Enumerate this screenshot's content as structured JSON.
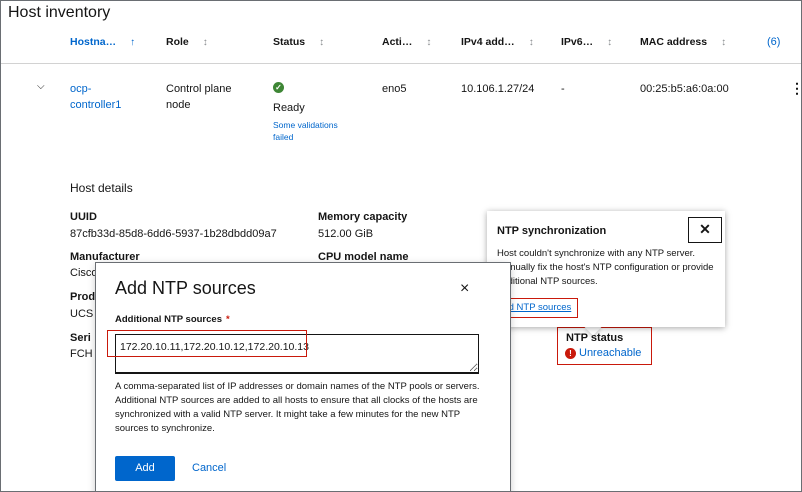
{
  "page": {
    "title": "Host inventory"
  },
  "table": {
    "columns": [
      {
        "label": "Hostna…",
        "sort_icon": "↑"
      },
      {
        "label": "Role",
        "sort_icon": "↕"
      },
      {
        "label": "Status",
        "sort_icon": "↕"
      },
      {
        "label": "Acti…",
        "sort_icon": "↕"
      },
      {
        "label": "IPv4 add…",
        "sort_icon": "↕"
      },
      {
        "label": "IPv6…",
        "sort_icon": "↕"
      },
      {
        "label": "MAC address",
        "sort_icon": "↕"
      }
    ],
    "count": "(6)",
    "row": {
      "hostname": "ocp-controller1",
      "role": "Control plane node",
      "status": "Ready",
      "status_note": "Some validations failed",
      "active_nic": "eno5",
      "ipv4": "10.106.1.27/24",
      "ipv6": "-",
      "mac": "00:25:b5:a6:0a:00"
    }
  },
  "details": {
    "title": "Host details",
    "uuid_label": "UUID",
    "uuid_value": "87cfb33d-85d8-6dd6-5937-1b28dbdd09a7",
    "memory_label": "Memory capacity",
    "memory_value": "512.00 GiB",
    "manufacturer_label": "Manufacturer",
    "manufacturer_value": "Cisco",
    "cpu_label": "CPU model name",
    "product_label": "Prod",
    "product_value": "UCS",
    "serial_label": "Seri",
    "serial_value": "FCH",
    "ntp_status_label": "NTP status",
    "ntp_status_value": "Unreachable"
  },
  "popover": {
    "title": "NTP synchronization",
    "body": "Host couldn't synchronize with any NTP server. Manually fix the host's NTP configuration or provide additional NTP sources.",
    "link": "Add NTP sources",
    "close": "✕"
  },
  "modal": {
    "title": "Add NTP sources",
    "close": "×",
    "field_label": "Additional NTP sources",
    "required_mark": "*",
    "input_value": "172.20.10.11,172.20.10.12,172.20.10.13",
    "helper": "A comma-separated list of IP addresses or domain names of the NTP pools or servers. Additional NTP sources are added to all hosts to ensure that all clocks of the hosts are synchronized with a valid NTP server. It might take a few minutes for the new NTP sources to synchronize.",
    "add_label": "Add",
    "cancel_label": "Cancel"
  },
  "colors": {
    "link": "#0066cc",
    "primary": "#0066cc",
    "success": "#3e8635",
    "danger": "#c9190b"
  },
  "icons": {
    "expand": "chevron-down-icon",
    "ok": "check-circle-icon",
    "error": "exclamation-circle-icon",
    "kebab": "kebab-icon"
  }
}
